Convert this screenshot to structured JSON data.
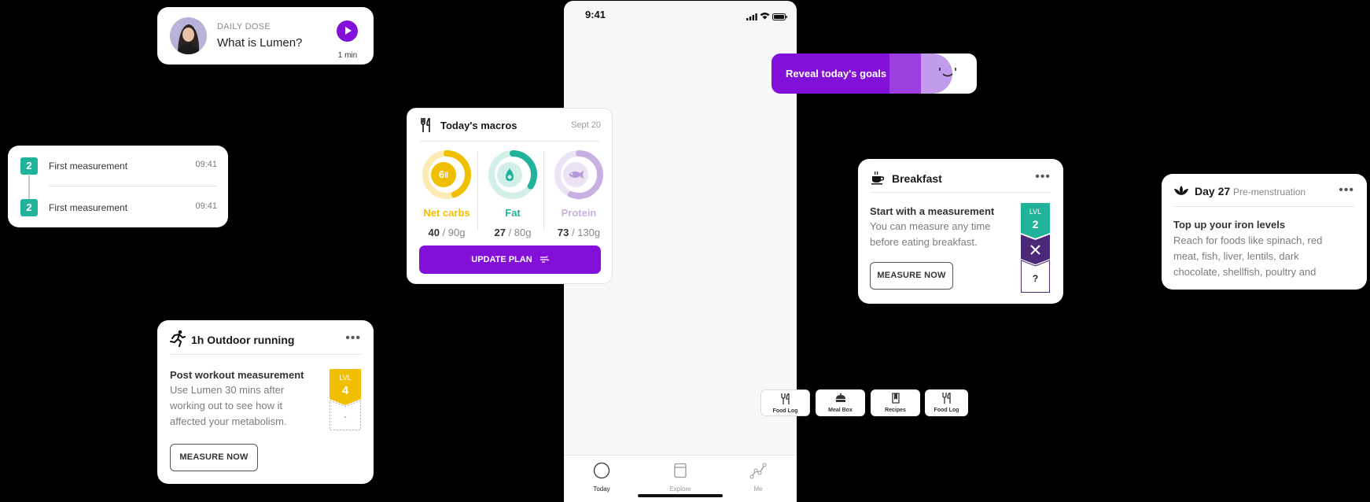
{
  "daily_dose": {
    "kicker": "DAILY DOSE",
    "title": "What is Lumen?",
    "duration": "1 min"
  },
  "measurements": {
    "items": [
      {
        "badge": "2",
        "label": "First measurement",
        "time": "09:41"
      },
      {
        "badge": "2",
        "label": "First measurement",
        "time": "09:41"
      }
    ]
  },
  "running": {
    "title": "1h Outdoor running",
    "heading": "Post workout measurement",
    "body_lines": [
      "Use Lumen 30 mins after",
      "working out to see how it",
      "affected your metabolism."
    ],
    "button": "MEASURE NOW",
    "level_label": "LVL",
    "level": "4",
    "level_next": "-"
  },
  "phone": {
    "time": "9:41",
    "tabs": [
      {
        "label": "Today"
      },
      {
        "label": "Explore"
      },
      {
        "label": "Me"
      }
    ]
  },
  "macros": {
    "title": "Today's macros",
    "date": "Sept 20",
    "items": [
      {
        "name": "Net carbs",
        "value": "40",
        "target": " / 90g",
        "fraction": 0.44,
        "color": "#f0bf00",
        "track": "#fbeab4"
      },
      {
        "name": "Fat",
        "value": "27",
        "target": " / 80g",
        "fraction": 0.34,
        "color": "#21b39a",
        "track": "#d2efea"
      },
      {
        "name": "Protein",
        "value": "73",
        "target": " / 130g",
        "fraction": 0.56,
        "color": "#c8b0e2",
        "track": "#ece3f5"
      }
    ],
    "carbs_icon_text": "6",
    "button": "UPDATE PLAN"
  },
  "reveal": {
    "label": "Reveal today's goals"
  },
  "breakfast": {
    "title": "Breakfast",
    "heading": "Start with a measurement",
    "body_lines": [
      "You can measure any time",
      "before eating breakfast."
    ],
    "button": "MEASURE NOW",
    "level_label": "LVL",
    "level": "2",
    "level_next": "?"
  },
  "day27": {
    "title": "Day 27",
    "subtitle": "Pre-menstruation",
    "heading": "Top up your iron levels",
    "body_lines": [
      "Reach for foods like spinach, red",
      "meat, fish, liver, lentils, dark",
      "chocolate, shellfish, poultry and"
    ]
  },
  "bottom_tabs": [
    {
      "label": "Food Log",
      "icon": "fork-knife-icon"
    },
    {
      "label": "Meal Box",
      "icon": "meal-box-icon"
    },
    {
      "label": "Recipes",
      "icon": "recipe-book-icon"
    },
    {
      "label": "Food Log",
      "icon": "fork-knife-icon"
    }
  ],
  "colors": {
    "purple": "#8210d8",
    "green": "#21b39a",
    "yellow": "#f0bf00",
    "dark_purple": "#4a2a78"
  }
}
